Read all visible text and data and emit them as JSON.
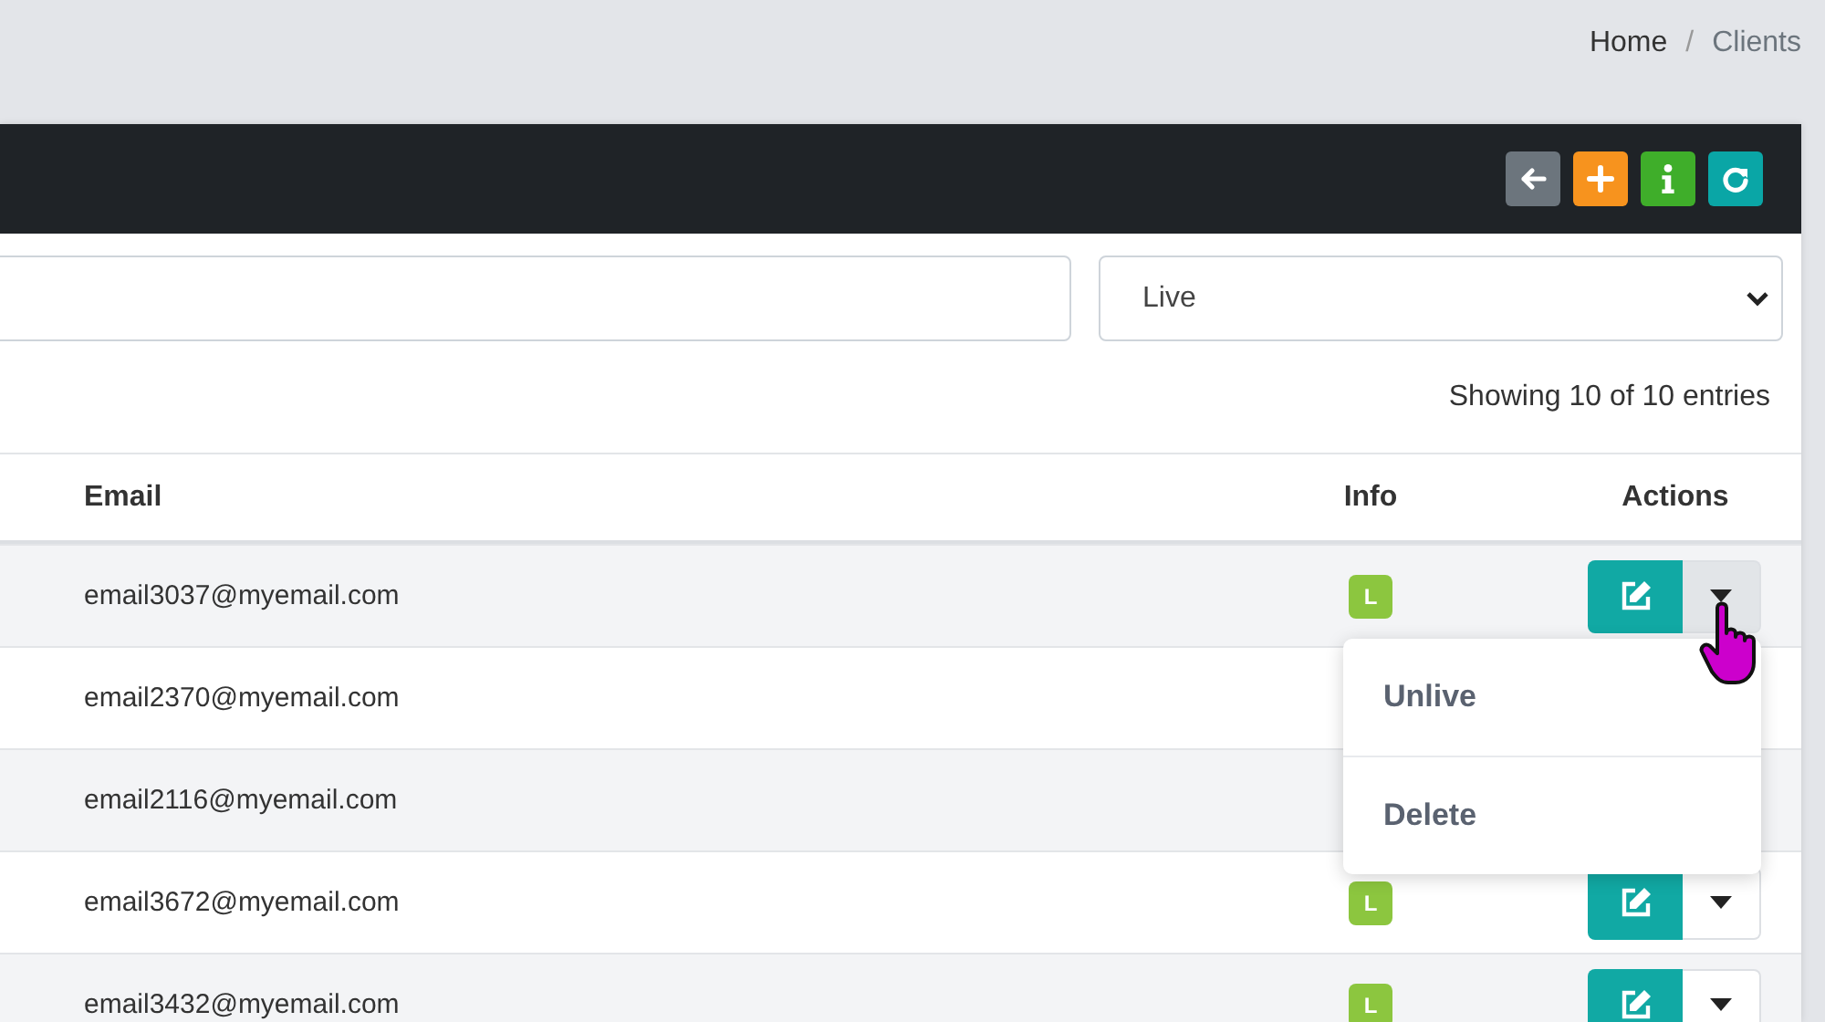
{
  "breadcrumb_separator": "/",
  "breadcrumb": [
    {
      "label": "Home",
      "kind": "link"
    },
    {
      "label": "Clients",
      "kind": "current"
    }
  ],
  "header_buttons": [
    {
      "kind": "back"
    },
    {
      "kind": "add"
    },
    {
      "kind": "info"
    },
    {
      "kind": "refresh"
    }
  ],
  "filter": {
    "status": "Live"
  },
  "summary": "Showing 10 of 10 entries",
  "table": {
    "columns": [
      "Email",
      "Info",
      "Actions"
    ],
    "rows": [
      {
        "email": "email3037@myemail.com",
        "info": "L",
        "actions": true,
        "expanded": true
      },
      {
        "email": "email2370@myemail.com"
      },
      {
        "email": "email2116@myemail.com"
      },
      {
        "email": "email3672@myemail.com",
        "info": "L",
        "actions": true,
        "expanded": false
      },
      {
        "email": "email3432@myemail.com",
        "info": "L",
        "actions": true,
        "expanded": false
      }
    ]
  },
  "menu": [
    "Unlive",
    "Delete"
  ]
}
